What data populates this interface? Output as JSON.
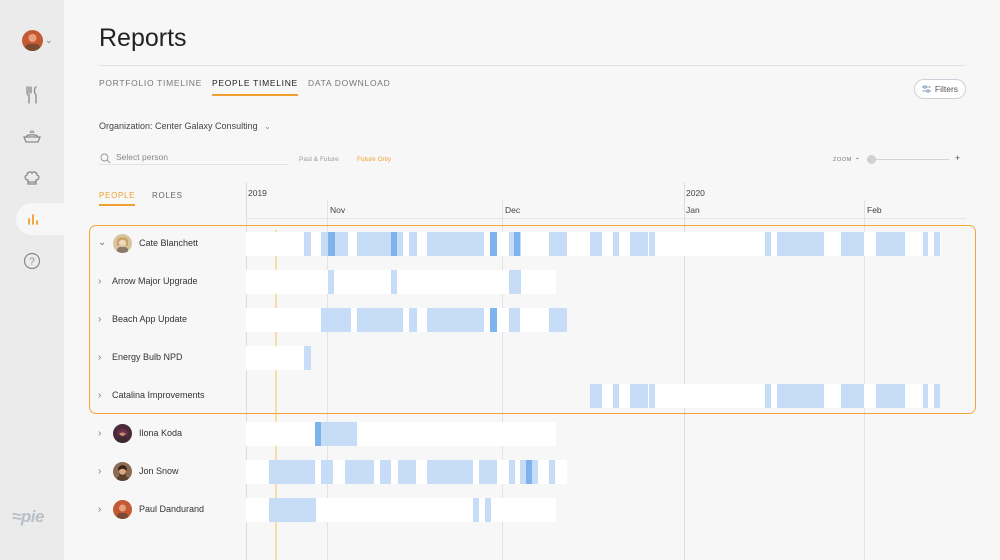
{
  "page": {
    "title": "Reports"
  },
  "tabs": [
    {
      "label": "PORTFOLIO TIMELINE",
      "active": false
    },
    {
      "label": "PEOPLE TIMELINE",
      "active": true
    },
    {
      "label": "DATA DOWNLOAD",
      "active": false
    }
  ],
  "filters_label": "Filters",
  "organization": "Organization: Center Galaxy Consulting",
  "search": {
    "placeholder": "Select person"
  },
  "time_filter": {
    "options": [
      "Past & Future",
      "Future Only"
    ],
    "active": "Future Only"
  },
  "zoom": {
    "label": "ZOOM",
    "minus": "-",
    "plus": "+",
    "level": 0
  },
  "people_tabs": [
    {
      "label": "PEOPLE",
      "active": true
    },
    {
      "label": "ROLES",
      "active": false
    }
  ],
  "timeline": {
    "years": [
      "2019",
      "2020"
    ],
    "months": [
      "Nov",
      "Dec",
      "Jan",
      "Feb"
    ]
  },
  "rows": [
    {
      "name": "Cate Blanchett",
      "type": "person",
      "expanded": true
    },
    {
      "name": "Arrow Major Upgrade",
      "type": "project"
    },
    {
      "name": "Beach App Update",
      "type": "project"
    },
    {
      "name": "Energy Bulb NPD",
      "type": "project"
    },
    {
      "name": "Catalina Improvements",
      "type": "project"
    },
    {
      "name": "Ilona Koda",
      "type": "person"
    },
    {
      "name": "Jon Snow",
      "type": "person"
    },
    {
      "name": "Paul Dandurand",
      "type": "person"
    }
  ],
  "logo": "pie",
  "colors": {
    "accent": "#f0a030",
    "bar": "#c6dcf7",
    "bar_dark": "#7fb3ee"
  }
}
